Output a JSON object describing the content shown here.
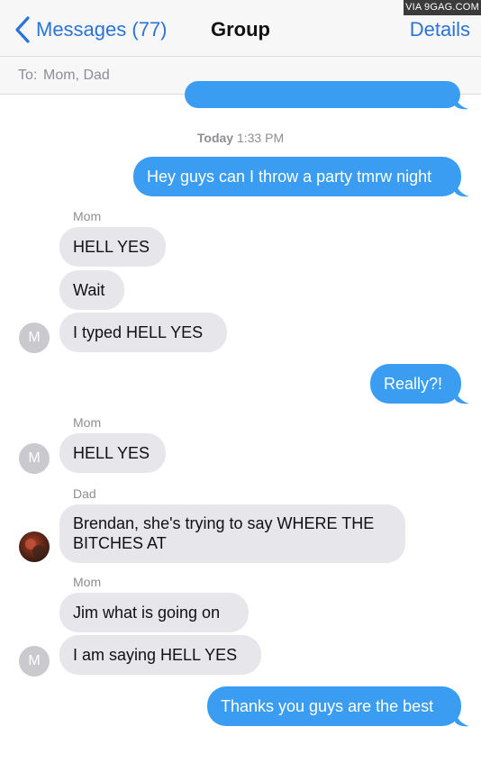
{
  "nav": {
    "back_label": "Messages (77)",
    "title": "Group",
    "details_label": "Details",
    "watermark": "VIA 9GAG.COM"
  },
  "to_bar": {
    "prefix": "To:",
    "names": "Mom, Dad"
  },
  "timestamp": {
    "day": "Today",
    "time": "1:33 PM"
  },
  "senders": {
    "mom": "Mom",
    "dad": "Dad",
    "mom_avatar_initial": "M"
  },
  "messages": [
    {
      "from": "me",
      "text": "Hey guys can I throw a party tmrw night"
    },
    {
      "from": "Mom",
      "text": "HELL YES"
    },
    {
      "from": "Mom",
      "text": "Wait"
    },
    {
      "from": "Mom",
      "text": "I typed HELL YES"
    },
    {
      "from": "me",
      "text": "Really?!"
    },
    {
      "from": "Mom",
      "text": "HELL YES"
    },
    {
      "from": "Dad",
      "line1": "Brendan, she's trying to say WHERE THE",
      "line2": "BITCHES AT"
    },
    {
      "from": "Mom",
      "text": "Jim what is going on"
    },
    {
      "from": "Mom",
      "text": "I am saying HELL YES"
    },
    {
      "from": "me",
      "text": "Thanks you guys are the best"
    }
  ],
  "colors": {
    "outgoing_bubble": "#3b9df2",
    "incoming_bubble": "#e6e6eb",
    "accent": "#2a73d9",
    "meta_text": "#8e8e93"
  }
}
